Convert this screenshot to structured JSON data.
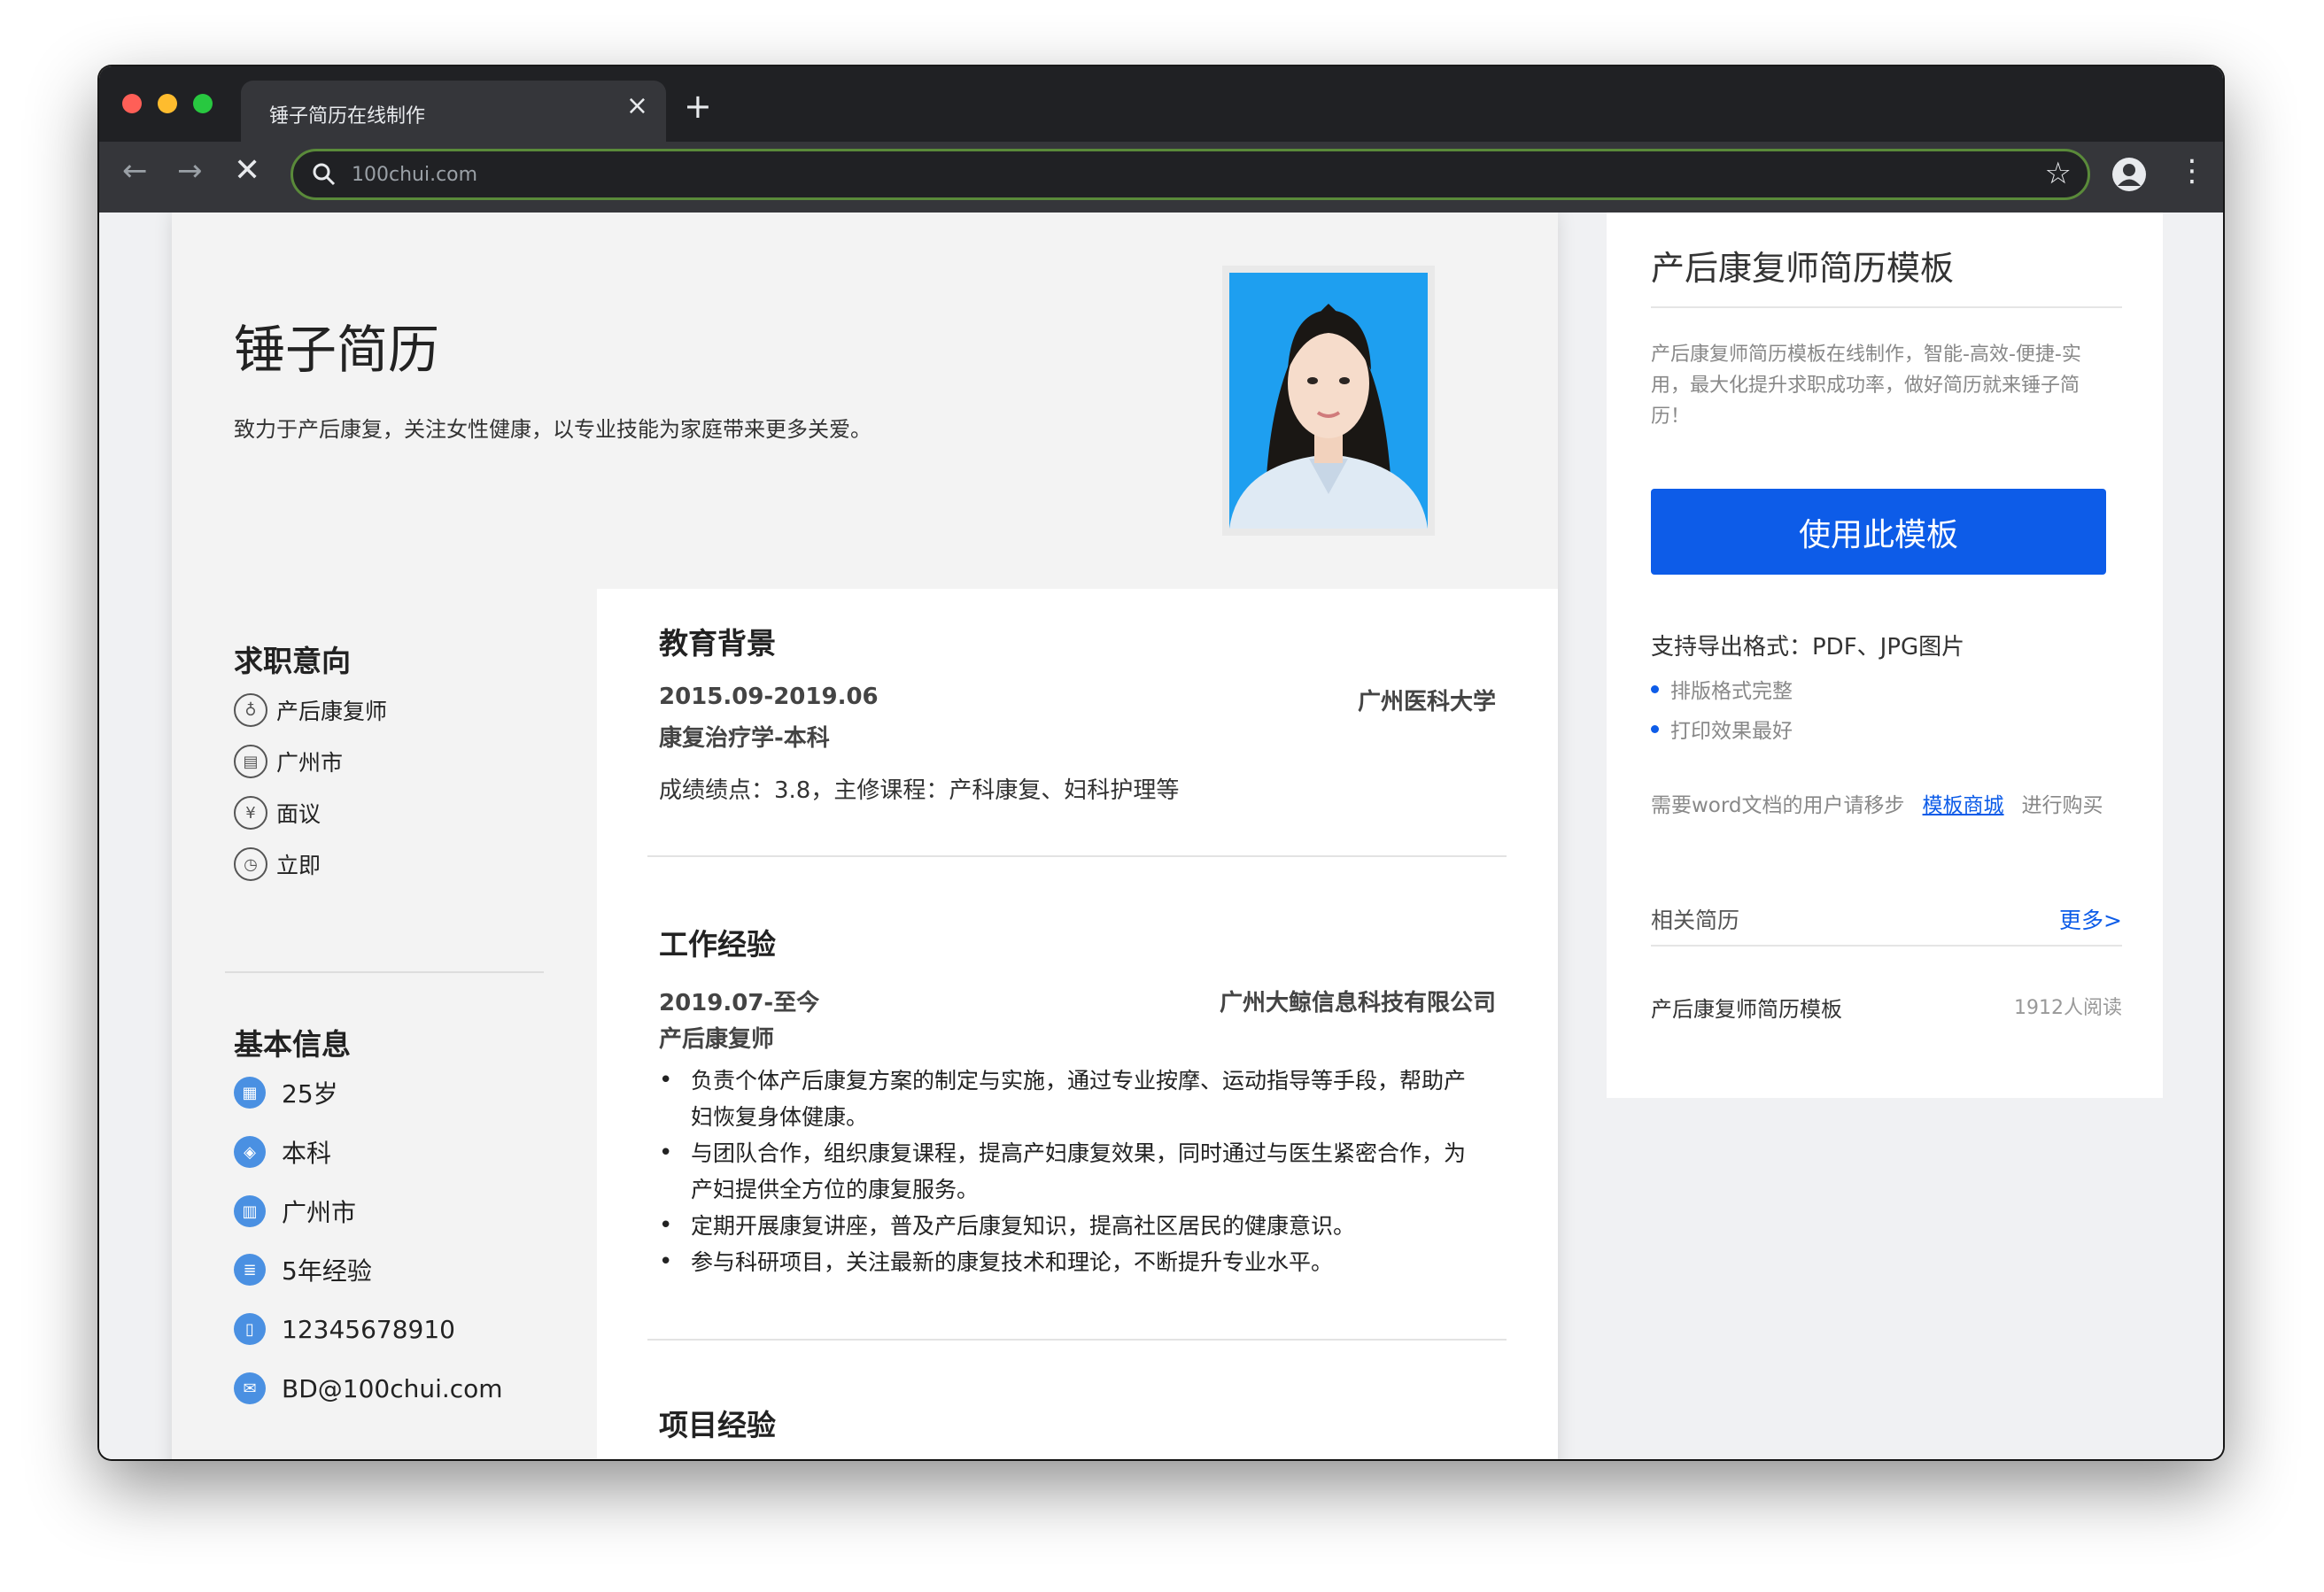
{
  "browser": {
    "tab_title": "锤子简历在线制作",
    "tab_close": "×",
    "new_tab": "+",
    "url": "100chui.com"
  },
  "resume": {
    "name": "锤子简历",
    "motto": "致力于产后康复，关注女性健康，以专业技能为家庭带来更多关爱。",
    "intent": {
      "title": "求职意向",
      "items": [
        {
          "icon": "tie-icon",
          "glyph": "♁",
          "text": "产后康复师"
        },
        {
          "icon": "building-icon",
          "glyph": "▤",
          "text": "广州市"
        },
        {
          "icon": "yen-icon",
          "glyph": "¥",
          "text": "面议"
        },
        {
          "icon": "clock-icon",
          "glyph": "◷",
          "text": "立即"
        }
      ]
    },
    "basic": {
      "title": "基本信息",
      "items": [
        {
          "icon": "calendar-icon",
          "glyph": "▦",
          "text": "25岁"
        },
        {
          "icon": "graduation-cap-icon",
          "glyph": "◈",
          "text": "本科"
        },
        {
          "icon": "building-icon",
          "glyph": "▥",
          "text": "广州市"
        },
        {
          "icon": "document-icon",
          "glyph": "≣",
          "text": "5年经验"
        },
        {
          "icon": "phone-icon",
          "glyph": "▯",
          "text": "12345678910"
        },
        {
          "icon": "mail-icon",
          "glyph": "✉",
          "text": "BD@100chui.com"
        }
      ]
    },
    "education": {
      "title": "教育背景",
      "period": "2015.09-2019.06",
      "school": "广州医科大学",
      "major": "康复治疗学-本科",
      "detail": "成绩绩点：3.8，主修课程：产科康复、妇科护理等"
    },
    "work": {
      "title": "工作经验",
      "period": "2019.07-至今",
      "company": "广州大鲸信息科技有限公司",
      "position": "产后康复师",
      "bullets": [
        "负责个体产后康复方案的制定与实施，通过专业按摩、运动指导等手段，帮助产妇恢复身体健康。",
        "与团队合作，组织康复课程，提高产妇康复效果，同时通过与医生紧密合作，为产妇提供全方位的康复服务。",
        "定期开展康复讲座，普及产后康复知识，提高社区居民的健康意识。",
        "参与科研项目，关注最新的康复技术和理论，不断提升专业水平。"
      ]
    },
    "project": {
      "title": "项目经验"
    }
  },
  "side": {
    "title": "产后康复师简历模板",
    "description": "产后康复师简历模板在线制作，智能-高效-便捷-实用，最大化提升求职成功率，做好简历就来锤子简历！",
    "use_button": "使用此模板",
    "export": "支持导出格式：PDF、JPG图片",
    "features": [
      "排版格式完整",
      "打印效果最好"
    ],
    "word_pre": "需要word文档的用户请移步",
    "word_link": "模板商城",
    "word_post": "进行购买",
    "related": "相关简历",
    "more": "更多>",
    "related_item": "产后康复师简历模板",
    "related_reads": "1912人阅读"
  },
  "colors": {
    "accent": "#0d5ce8",
    "icon_blue": "#4a90e2",
    "chrome_dark": "#202124",
    "omnibox_border": "#5a8a3a"
  }
}
